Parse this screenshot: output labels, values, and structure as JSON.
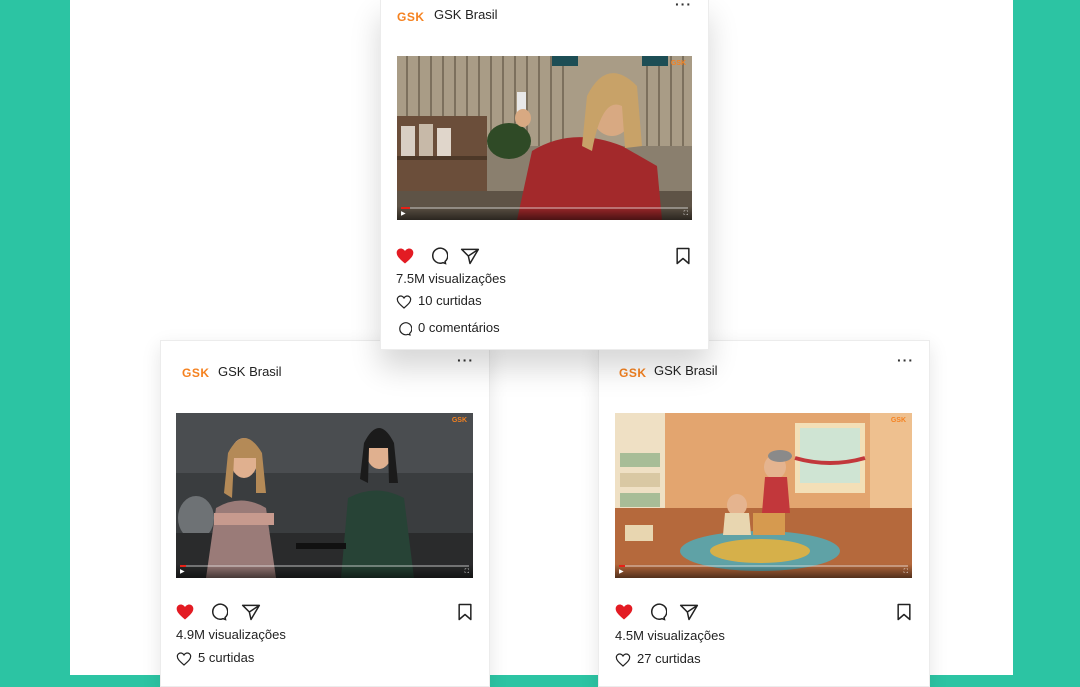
{
  "colors": {
    "background": "#2cc4a3",
    "brand": "#f58220",
    "like": "#e31b23"
  },
  "posts": [
    {
      "logo": "GSK",
      "account": "GSK Brasil",
      "media_watermark": "GSK",
      "views": "7.5M visualizações",
      "likes": "10 curtidas",
      "comments": "0 comentários"
    },
    {
      "logo": "GSK",
      "account": "GSK Brasil",
      "media_watermark": "GSK",
      "views": "4.9M visualizações",
      "likes": "5 curtidas"
    },
    {
      "logo": "GSK",
      "account": "GSK Brasil",
      "media_watermark": "GSK",
      "views": "4.5M visualizações",
      "likes": "27 curtidas"
    }
  ],
  "icons": {
    "like": "heart-icon",
    "comment": "comment-icon",
    "share": "send-icon",
    "save": "bookmark-icon",
    "more": "more-options-icon"
  }
}
